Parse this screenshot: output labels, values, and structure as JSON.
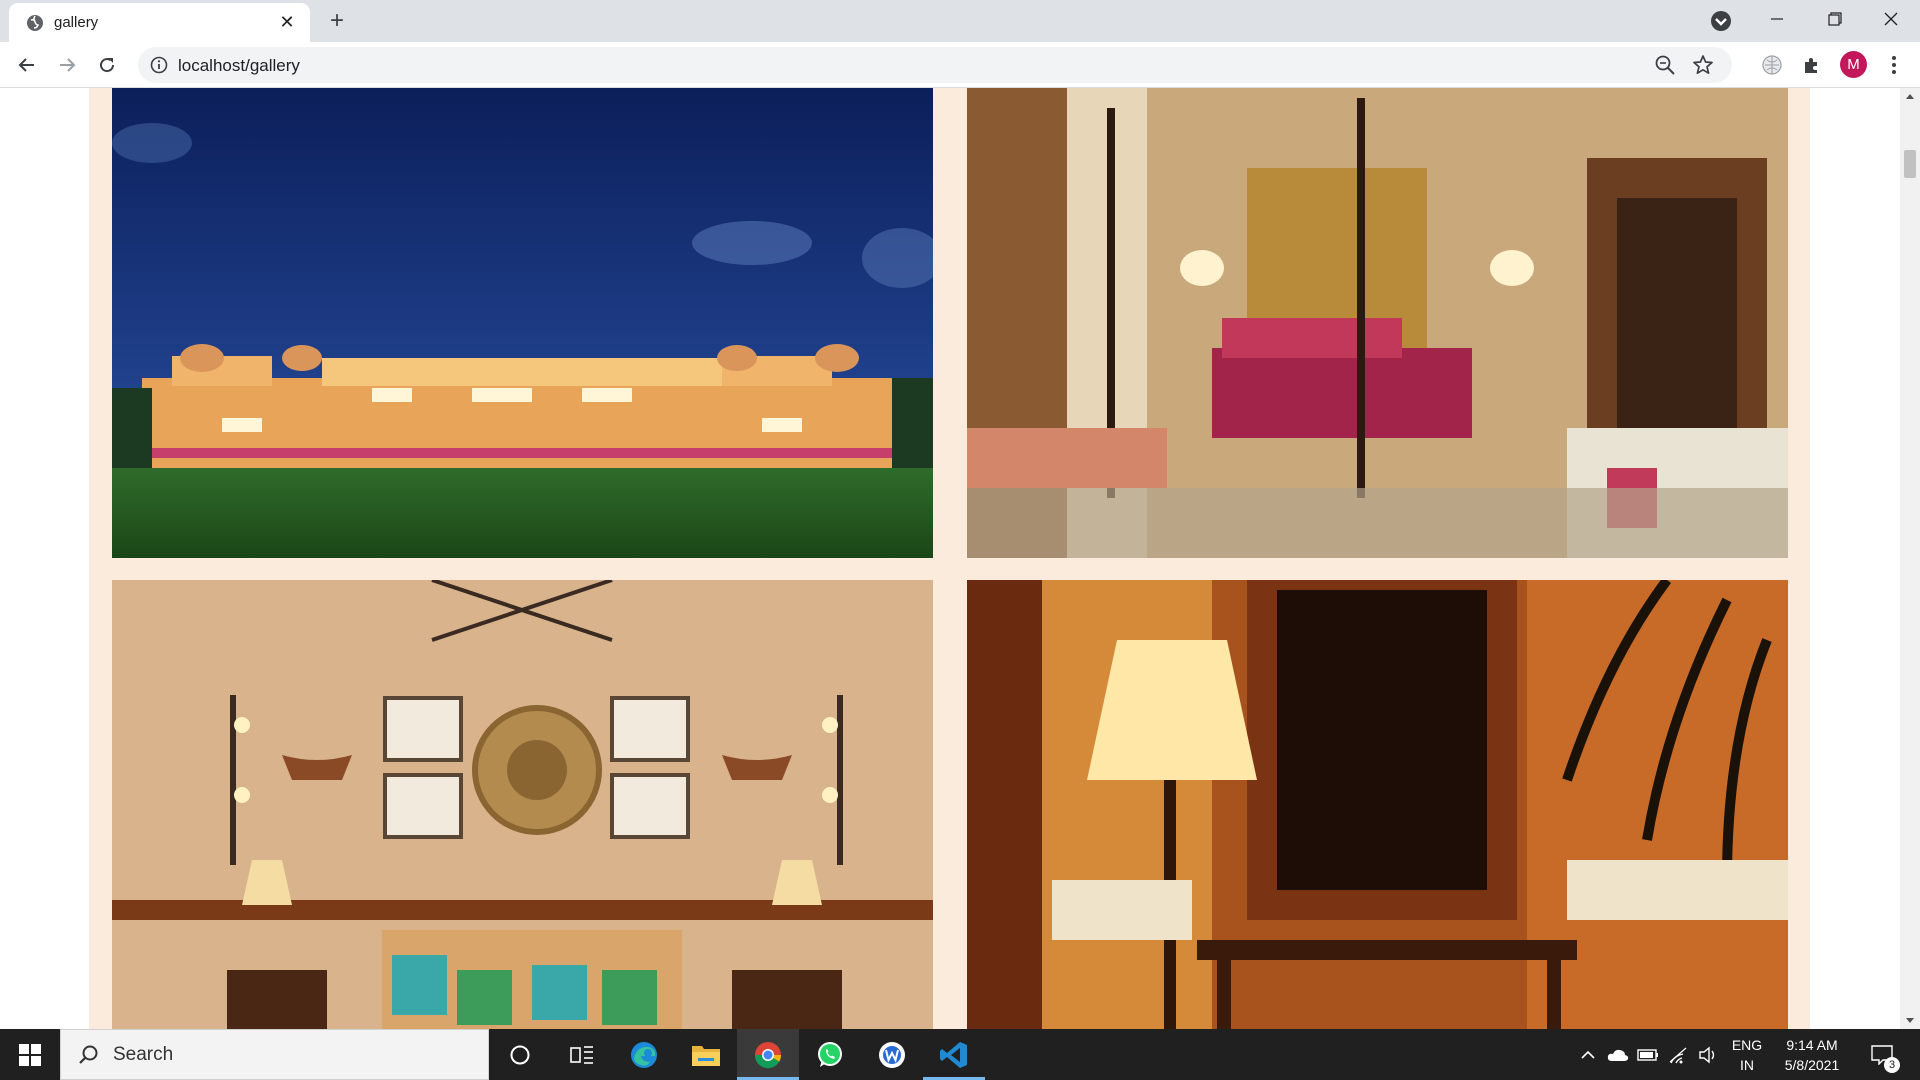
{
  "browser": {
    "tab_title": "gallery",
    "new_tab_symbol": "+",
    "url": "localhost/gallery",
    "profile_initial": "M",
    "colors": {
      "tabstrip": "#dee1e6",
      "profile": "#c2185b"
    }
  },
  "page": {
    "background": "#faebdc",
    "images": [
      {
        "alt": "palace-exterior-night"
      },
      {
        "alt": "four-poster-bedroom"
      },
      {
        "alt": "polo-lounge-interior"
      },
      {
        "alt": "peacock-mirror-console"
      }
    ]
  },
  "taskbar": {
    "search_placeholder": "Search",
    "apps": [
      "cortana",
      "task-view",
      "edge",
      "file-explorer",
      "chrome",
      "whatsapp",
      "app-w",
      "vscode"
    ],
    "language_line1": "ENG",
    "language_line2": "IN",
    "time": "9:14 AM",
    "date": "5/8/2021",
    "notifications_count": "3"
  }
}
